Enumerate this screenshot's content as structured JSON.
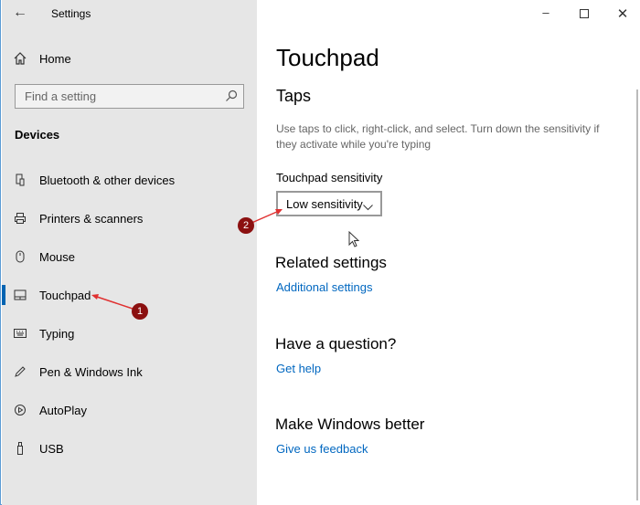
{
  "window": {
    "title": "Settings"
  },
  "sidebar": {
    "home_label": "Home",
    "search_placeholder": "Find a setting",
    "section_title": "Devices",
    "items": [
      {
        "label": "Bluetooth & other devices",
        "icon": "bluetooth-icon"
      },
      {
        "label": "Printers & scanners",
        "icon": "printer-icon"
      },
      {
        "label": "Mouse",
        "icon": "mouse-icon"
      },
      {
        "label": "Touchpad",
        "icon": "touchpad-icon",
        "selected": true
      },
      {
        "label": "Typing",
        "icon": "keyboard-icon"
      },
      {
        "label": "Pen & Windows Ink",
        "icon": "pen-icon"
      },
      {
        "label": "AutoPlay",
        "icon": "autoplay-icon"
      },
      {
        "label": "USB",
        "icon": "usb-icon"
      }
    ]
  },
  "main": {
    "title": "Touchpad",
    "taps_heading": "Taps",
    "taps_description": "Use taps to click, right-click, and select. Turn down the sensitivity if they activate while you're typing",
    "sensitivity_label": "Touchpad sensitivity",
    "sensitivity_value": "Low sensitivity",
    "related_heading": "Related settings",
    "related_link": "Additional settings",
    "question_heading": "Have a question?",
    "question_link": "Get help",
    "better_heading": "Make Windows better",
    "better_link": "Give us feedback"
  },
  "annotations": [
    "1",
    "2"
  ],
  "colors": {
    "accent": "#0067c0",
    "annotation": "#8b1010",
    "arrow": "#e03030"
  }
}
